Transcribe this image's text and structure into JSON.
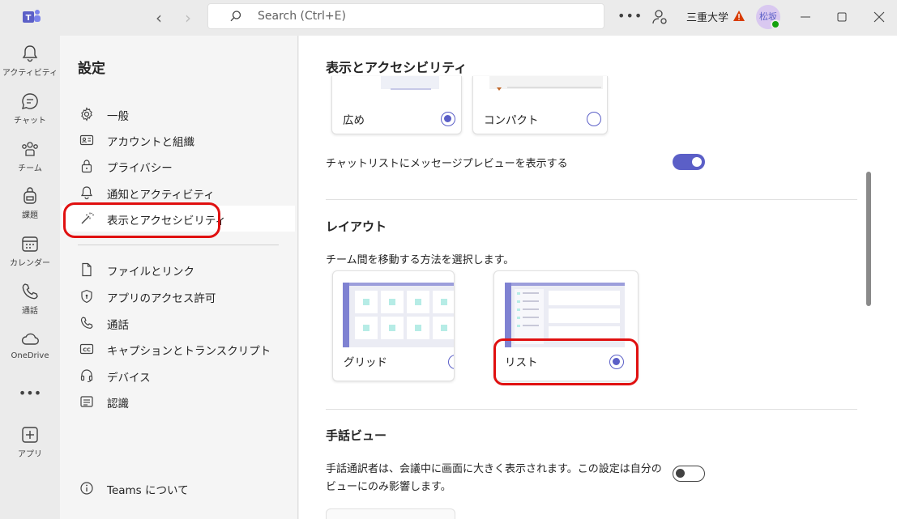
{
  "titlebar": {
    "search_placeholder": "Search (Ctrl+E)",
    "org_name": "三重大学",
    "avatar_initials": "松坂"
  },
  "rail": [
    {
      "label": "アクティビティ",
      "icon": "bell-icon"
    },
    {
      "label": "チャット",
      "icon": "chat-icon"
    },
    {
      "label": "チーム",
      "icon": "teams-icon"
    },
    {
      "label": "課題",
      "icon": "backpack-icon"
    },
    {
      "label": "カレンダー",
      "icon": "calendar-icon"
    },
    {
      "label": "通話",
      "icon": "phone-icon"
    },
    {
      "label": "OneDrive",
      "icon": "cloud-icon"
    },
    {
      "label": "アプリ",
      "icon": "plus-square-icon"
    }
  ],
  "settings": {
    "title": "設定",
    "items": [
      {
        "label": "一般",
        "icon": "gear-icon"
      },
      {
        "label": "アカウントと組織",
        "icon": "id-card-icon"
      },
      {
        "label": "プライバシー",
        "icon": "lock-icon"
      },
      {
        "label": "通知とアクティビティ",
        "icon": "bell-icon"
      },
      {
        "label": "表示とアクセシビリティ",
        "icon": "wand-icon"
      },
      {
        "label": "ファイルとリンク",
        "icon": "file-icon"
      },
      {
        "label": "アプリのアクセス許可",
        "icon": "shield-icon"
      },
      {
        "label": "通話",
        "icon": "phone-icon"
      },
      {
        "label": "キャプションとトランスクリプト",
        "icon": "cc-icon"
      },
      {
        "label": "デバイス",
        "icon": "headset-icon"
      },
      {
        "label": "認識",
        "icon": "list-icon"
      }
    ],
    "about": "Teams について"
  },
  "main": {
    "title": "表示とアクセシビリティ",
    "density": {
      "options": [
        {
          "label": "広め",
          "selected": true
        },
        {
          "label": "コンパクト",
          "selected": false
        }
      ]
    },
    "chat_preview": {
      "label": "チャットリストにメッセージプレビューを表示する",
      "on": true
    },
    "layout": {
      "title": "レイアウト",
      "description": "チーム間を移動する方法を選択します。",
      "options": [
        {
          "label": "グリッド",
          "selected": false
        },
        {
          "label": "リスト",
          "selected": true
        }
      ]
    },
    "sign_language": {
      "title": "手話ビュー",
      "description_line1": "手話通訳者は、会議中に画面に大きく表示されます。この設定は自分の",
      "description_line2": "ビューにのみ影響します。",
      "on": false
    }
  },
  "colors": {
    "accent": "#5b5fc7",
    "annotation": "#e01010"
  }
}
